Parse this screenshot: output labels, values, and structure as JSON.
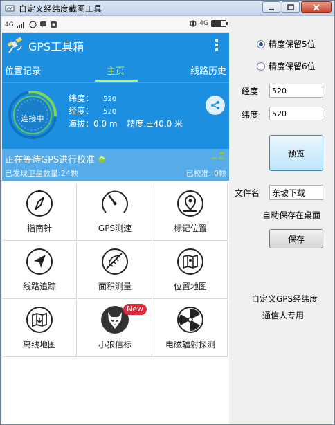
{
  "window": {
    "title": "自定义经纬度截图工具"
  },
  "phone": {
    "statusbar": {
      "network_left": "4G",
      "network_right": "4G",
      "battery_fraction": 0.7
    },
    "app_title": "GPS工具箱",
    "tabs": [
      {
        "label": "位置记录",
        "active": false
      },
      {
        "label": "主页",
        "active": true
      },
      {
        "label": "线路历史",
        "active": false
      }
    ],
    "status": {
      "gauge_label": "连接中",
      "latitude_label": "纬度：",
      "latitude_value": "520",
      "longitude_label": "经度：",
      "longitude_value": "520",
      "altitude_text": "海拔：0.0 m",
      "accuracy_text": "精度:±40.0 米"
    },
    "gps_banner": {
      "waiting_text": "正在等待GPS进行校准",
      "satellites_text": "已发现卫星数量:24颗",
      "calibrated_text": "已校准: 0颗"
    },
    "tools": [
      {
        "label": "指南针",
        "icon": "compass-icon"
      },
      {
        "label": "GPS测速",
        "icon": "speedometer-icon"
      },
      {
        "label": "标记位置",
        "icon": "map-pin-icon"
      },
      {
        "label": "线路追踪",
        "icon": "navigation-arrow-icon"
      },
      {
        "label": "面积测量",
        "icon": "protractor-icon"
      },
      {
        "label": "位置地图",
        "icon": "folded-map-icon"
      },
      {
        "label": "离线地图",
        "icon": "offline-map-icon"
      },
      {
        "label": "小狼信标",
        "icon": "wolf-icon",
        "badge": "New"
      },
      {
        "label": "电磁辐射探测",
        "icon": "radiation-icon"
      }
    ]
  },
  "panel": {
    "precision_5": {
      "label": "精度保留5位",
      "selected": true
    },
    "precision_6": {
      "label": "精度保留6位",
      "selected": false
    },
    "longitude_label": "经度",
    "longitude_value": "520",
    "latitude_label": "纬度",
    "latitude_value": "520",
    "preview_label": "预览",
    "filename_label": "文件名",
    "filename_value": "东坡下载",
    "autosave_text": "自动保存在桌面",
    "save_label": "保存",
    "footer_line1": "自定义GPS经纬度",
    "footer_line2": "通信人专用"
  },
  "colors": {
    "app_blue": "#1d8fe0",
    "banner_blue": "#56abe8",
    "accent_green": "#bff06a",
    "badge_red": "#e0293a"
  }
}
